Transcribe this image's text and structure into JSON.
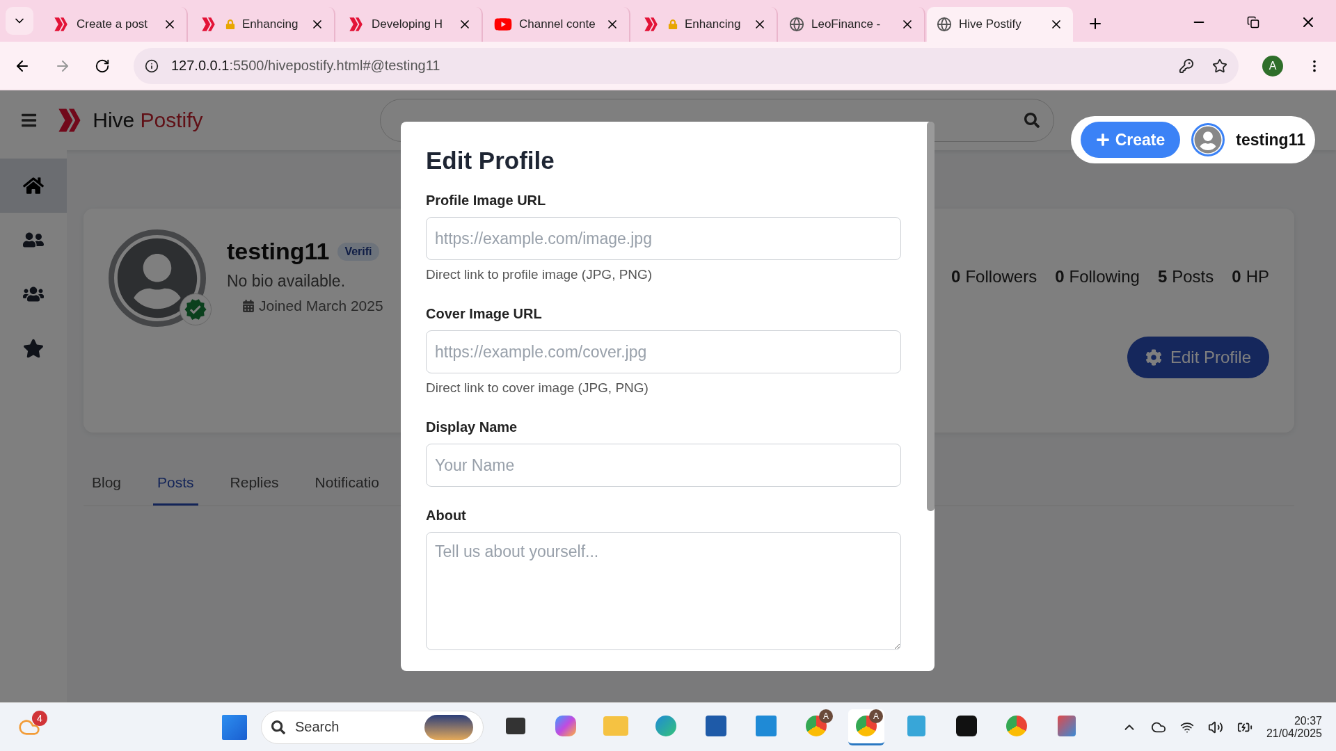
{
  "browser": {
    "tabs": [
      {
        "title": "Create a post",
        "kind": "hive",
        "selected": false
      },
      {
        "title": "Enhancing",
        "kind": "hive-lock",
        "selected": false
      },
      {
        "title": "Developing H",
        "kind": "hive",
        "selected": false
      },
      {
        "title": "Channel conte",
        "kind": "youtube",
        "selected": false
      },
      {
        "title": "Enhancing",
        "kind": "hive-lock",
        "selected": false
      },
      {
        "title": "LeoFinance -",
        "kind": "globe",
        "selected": false
      },
      {
        "title": "Hive Postify",
        "kind": "globe",
        "selected": true
      }
    ],
    "url_host": "127.0.0.1",
    "url_rest": ":5500/hivepostify.html#@testing11",
    "profile_initial": "A"
  },
  "app": {
    "brand_first": "Hive",
    "brand_second": "Postify",
    "create_label": "Create",
    "user": "testing11",
    "sidebar": [
      {
        "kind": "home",
        "selected": true
      },
      {
        "kind": "friends",
        "selected": false
      },
      {
        "kind": "groups",
        "selected": false
      },
      {
        "kind": "star",
        "selected": false
      }
    ],
    "profile": {
      "name": "testing11",
      "badge": "Verifi",
      "bio": "No bio available.",
      "joined": "Joined March 2025",
      "stats": [
        "**0** Followers",
        "**0** Following",
        "**5** Posts",
        "**0** HP"
      ],
      "edit_button": "Edit Profile"
    },
    "tabs": [
      {
        "label": "Blog",
        "selected": false
      },
      {
        "label": "Posts",
        "selected": true
      },
      {
        "label": "Replies",
        "selected": false
      },
      {
        "label": "Notificatio",
        "selected": false
      }
    ],
    "modal": {
      "title": "Edit Profile",
      "fields": [
        {
          "kind": "input",
          "label": "Profile Image URL",
          "placeholder": "https://example.com/image.jpg",
          "help": "Direct link to profile image (JPG, PNG)"
        },
        {
          "kind": "input",
          "label": "Cover Image URL",
          "placeholder": "https://example.com/cover.jpg",
          "help": "Direct link to cover image (JPG, PNG)"
        },
        {
          "kind": "input",
          "label": "Display Name",
          "placeholder": "Your Name"
        },
        {
          "kind": "textarea",
          "label": "About",
          "placeholder": "Tell us about yourself..."
        }
      ]
    }
  },
  "taskbar": {
    "weather_badge": "4",
    "search": "Search",
    "apps": [
      {
        "kind": "taskview",
        "selected": false
      },
      {
        "kind": "copilot",
        "selected": false
      },
      {
        "kind": "folder",
        "selected": false
      },
      {
        "kind": "edge",
        "selected": false
      },
      {
        "kind": "store",
        "selected": false
      },
      {
        "kind": "vscode",
        "selected": false
      },
      {
        "kind": "chrome",
        "badge": "A",
        "selected": false
      },
      {
        "kind": "chrome",
        "badge": "A",
        "selected": true
      },
      {
        "kind": "notepad",
        "selected": false
      },
      {
        "kind": "capcut",
        "selected": false
      },
      {
        "kind": "chrome",
        "selected": false
      },
      {
        "kind": "snip",
        "selected": false
      }
    ],
    "time": "20:37",
    "date": "21/04/2025"
  }
}
